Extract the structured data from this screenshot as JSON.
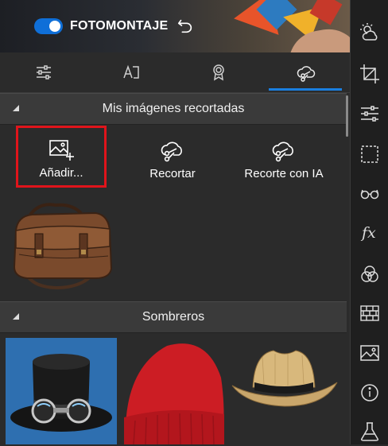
{
  "header": {
    "toggle_on": true,
    "title": "FOTOMONTAJE",
    "undo_icon": "undo-icon"
  },
  "tabs": [
    {
      "icon": "sliders-icon",
      "active": false
    },
    {
      "icon": "text-icon",
      "active": false
    },
    {
      "icon": "badge-icon",
      "active": false
    },
    {
      "icon": "cutout-icon",
      "active": true
    }
  ],
  "sections": {
    "cutouts": {
      "title": "Mis imágenes recortadas",
      "actions": [
        {
          "label": "Añadir...",
          "icon": "add-image-icon",
          "highlighted": true
        },
        {
          "label": "Recortar",
          "icon": "cutout-icon"
        },
        {
          "label": "Recorte con IA",
          "icon": "ai-cutout-icon"
        }
      ],
      "items": [
        {
          "icon": "leather-bag-image"
        }
      ]
    },
    "hats": {
      "title": "Sombreros",
      "items": [
        {
          "icon": "top-hat-goggles-image"
        },
        {
          "icon": "red-beanie-image"
        },
        {
          "icon": "straw-cowboy-hat-image"
        }
      ]
    }
  },
  "right_toolbar": [
    {
      "icon": "weather-icon"
    },
    {
      "icon": "crop-icon"
    },
    {
      "icon": "adjustments-icon"
    },
    {
      "icon": "selection-icon"
    },
    {
      "icon": "glasses-icon"
    },
    {
      "icon": "fx-icon",
      "label": "fx"
    },
    {
      "icon": "color-circles-icon"
    },
    {
      "icon": "bricks-icon"
    },
    {
      "icon": "image-icon"
    },
    {
      "icon": "info-icon"
    },
    {
      "icon": "flask-icon"
    }
  ],
  "colors": {
    "accent": "#1a7fe0",
    "highlight_border": "#e0141b",
    "panel_bg": "#2b2b2b",
    "section_bg": "#3a3a3a",
    "toolbar_bg": "#1f1f1f"
  }
}
